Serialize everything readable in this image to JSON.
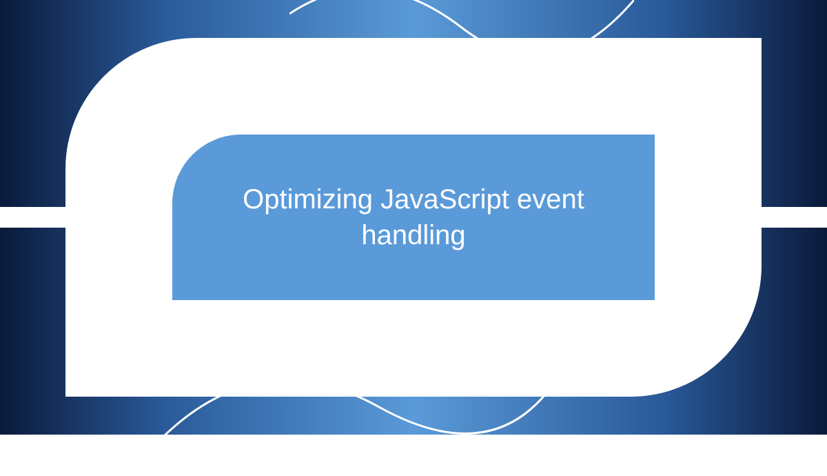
{
  "hero": {
    "title": "Optimizing JavaScript event handling"
  },
  "colors": {
    "panel_bg": "#5b9ad9",
    "frame_bg": "#ffffff",
    "title_text": "#ffffff"
  }
}
